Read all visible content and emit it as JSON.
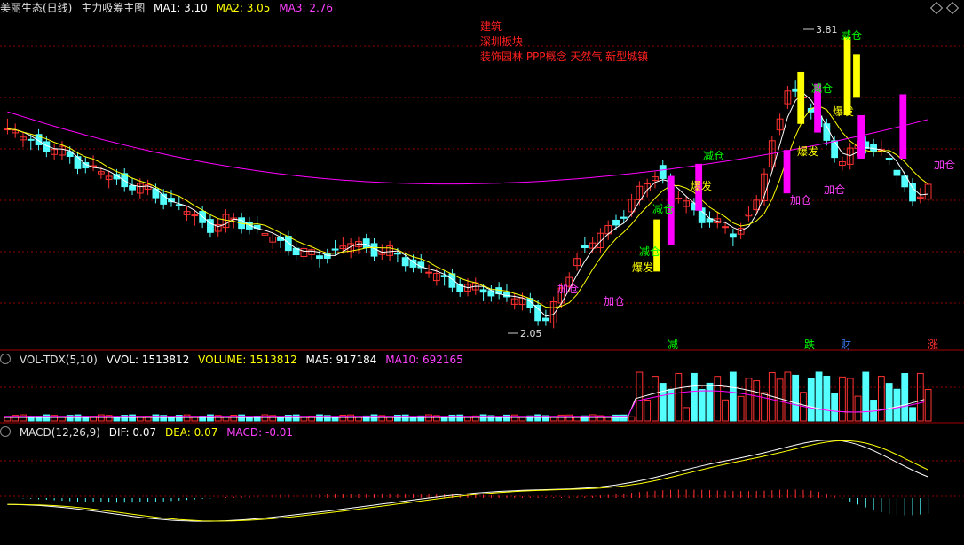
{
  "main_header": {
    "stock": "美丽生态(日线)",
    "indicator": "主力吸筹主图",
    "ma1": "MA1: 3.10",
    "ma2": "MA2: 3.05",
    "ma3": "MA3: 2.76"
  },
  "sector_info": {
    "industry": "建筑",
    "board": "深圳板块",
    "concepts": "装饰园林 PPP概念 天然气 新型城镇"
  },
  "vol_header": {
    "name": "VOL-TDX(5,10)",
    "vvol": "VVOL: 1513812",
    "volume": "VOLUME: 1513812",
    "ma5": "MA5: 917184",
    "ma10": "MA10: 692165"
  },
  "macd_header": {
    "name": "MACD(12,26,9)",
    "dif": "DIF: 0.07",
    "dea": "DEA: 0.07",
    "macd": "MACD: -0.01"
  },
  "price_marks": {
    "high": "3.81",
    "low": "2.05"
  },
  "signal_labels": {
    "jiacang": "加仓",
    "jiancang": "减仓",
    "baofa": "爆发"
  },
  "bottom_markers": [
    {
      "text": "减",
      "color": "#00ff00"
    },
    {
      "text": "跌",
      "color": "#00ff00"
    },
    {
      "text": "财",
      "color": "#4080ff"
    },
    {
      "text": "涨",
      "color": "#ff3030"
    }
  ],
  "colors": {
    "up": "#ff3232",
    "down": "#54ffff",
    "ma1": "#ffffff",
    "ma2": "#ffff00",
    "ma3": "#ff00ff",
    "grid": "#8b0000",
    "signal_yellow": "#ffff00",
    "signal_magenta": "#ff00ff"
  }
}
